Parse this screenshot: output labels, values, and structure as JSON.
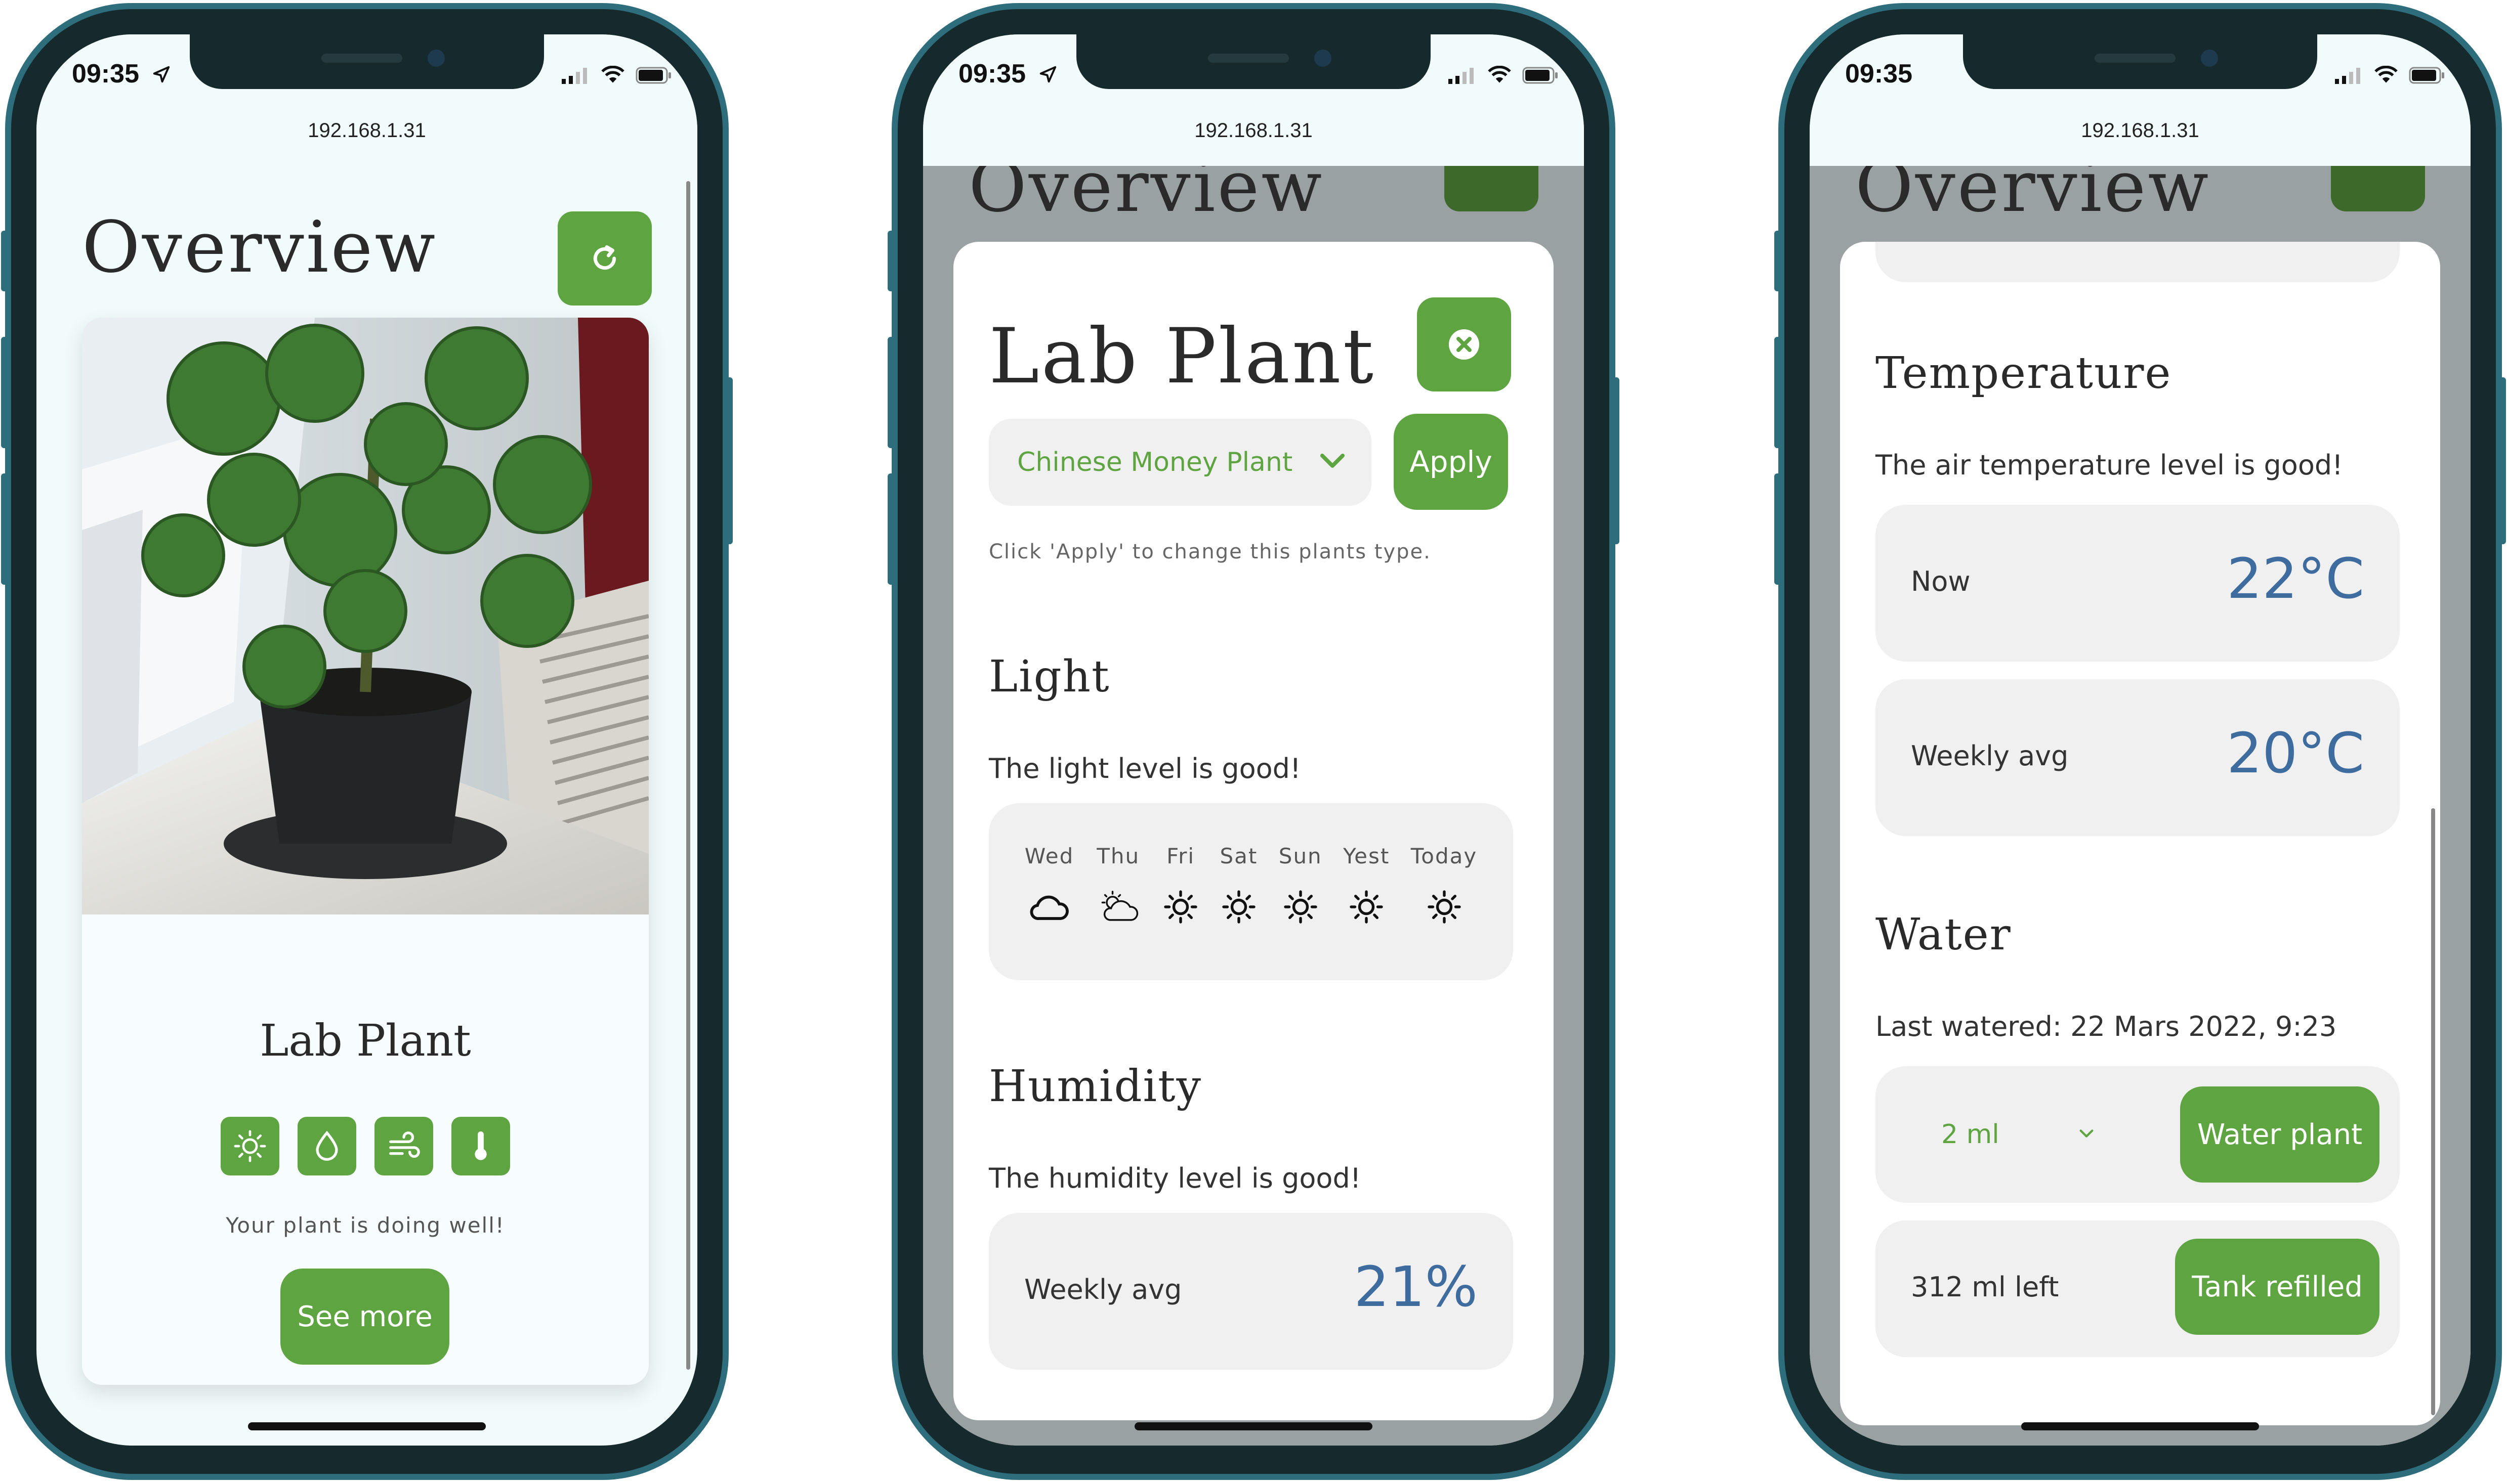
{
  "status": {
    "time": "09:35",
    "url": "192.168.1.31"
  },
  "overview": {
    "title": "Overview",
    "plant_name": "Lab Plant",
    "status_message": "Your plant is doing well!",
    "see_more_label": "See more",
    "status_icons": [
      "sun-icon",
      "droplet-icon",
      "wind-icon",
      "thermometer-icon"
    ]
  },
  "modal": {
    "title": "Lab Plant",
    "plant_type": "Chinese Money Plant",
    "apply_label": "Apply",
    "hint": "Click 'Apply' to change this plants type.",
    "light": {
      "heading": "Light",
      "message": "The light level is good!",
      "days": [
        {
          "label": "Wed",
          "icon": "cloud-icon"
        },
        {
          "label": "Thu",
          "icon": "partly-cloudy-icon"
        },
        {
          "label": "Fri",
          "icon": "sun-icon"
        },
        {
          "label": "Sat",
          "icon": "sun-icon"
        },
        {
          "label": "Sun",
          "icon": "sun-icon"
        },
        {
          "label": "Yest",
          "icon": "sun-icon"
        },
        {
          "label": "Today",
          "icon": "sun-icon"
        }
      ]
    },
    "humidity": {
      "heading": "Humidity",
      "message": "The humidity level is good!",
      "weekly_label": "Weekly avg",
      "weekly_value": "21%"
    },
    "temperature": {
      "heading": "Temperature",
      "message": "The air temperature level is good!",
      "now_label": "Now",
      "now_value": "22°C",
      "weekly_label": "Weekly avg",
      "weekly_value": "20°C"
    },
    "water": {
      "heading": "Water",
      "last_watered": "Last watered: 22 Mars 2022, 9:23",
      "amount": "2 ml",
      "water_label": "Water plant",
      "tank_left": "312 ml left",
      "tank_label": "Tank refilled"
    }
  },
  "colors": {
    "accent": "#5ea542",
    "value_blue": "#3e6c9e",
    "frame": "#2d6d7c"
  }
}
